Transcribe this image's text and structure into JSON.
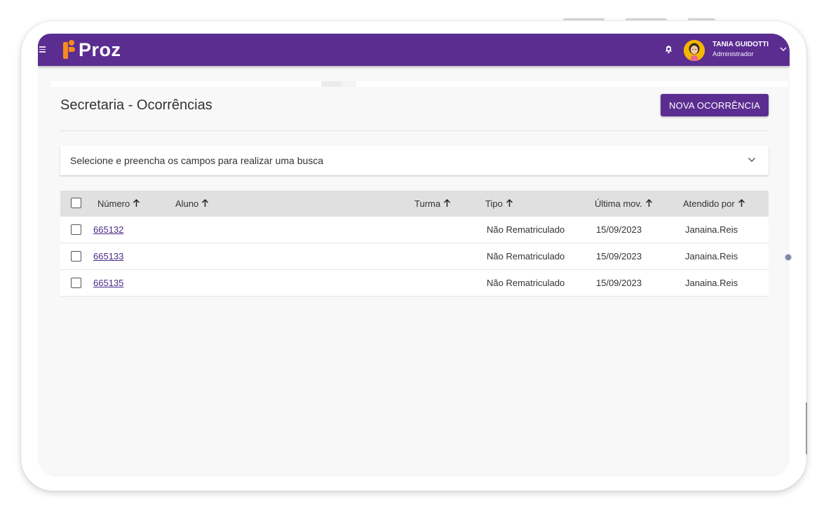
{
  "app": {
    "logo_text": "Proz",
    "brand_color": "#5b2d91",
    "accent_color": "#f68b1f"
  },
  "header": {
    "user_name": "TANIA GUIDOTTI",
    "user_role": "Administrador",
    "icons": [
      "menu-icon",
      "bell-icon",
      "avatar",
      "chevron-down-icon"
    ]
  },
  "page": {
    "title": "Secretaria - Ocorrências",
    "new_button_label": "NOVA OCORRÊNCIA"
  },
  "search": {
    "label": "Selecione e preencha os campos para realizar uma busca"
  },
  "table": {
    "columns": [
      {
        "label": "Número"
      },
      {
        "label": "Aluno"
      },
      {
        "label": "Turma"
      },
      {
        "label": "Tipo"
      },
      {
        "label": "Última mov."
      },
      {
        "label": "Atendido por"
      }
    ],
    "rows": [
      {
        "numero": "665132",
        "aluno": "",
        "turma": "",
        "tipo": "Não Rematriculado",
        "ultima_mov": "15/09/2023",
        "atendido_por": "Janaina.Reis"
      },
      {
        "numero": "665133",
        "aluno": "",
        "turma": "",
        "tipo": "Não Rematriculado",
        "ultima_mov": "15/09/2023",
        "atendido_por": "Janaina.Reis"
      },
      {
        "numero": "665135",
        "aluno": "",
        "turma": "",
        "tipo": "Não Rematriculado",
        "ultima_mov": "15/09/2023",
        "atendido_por": "Janaina.Reis"
      }
    ]
  }
}
